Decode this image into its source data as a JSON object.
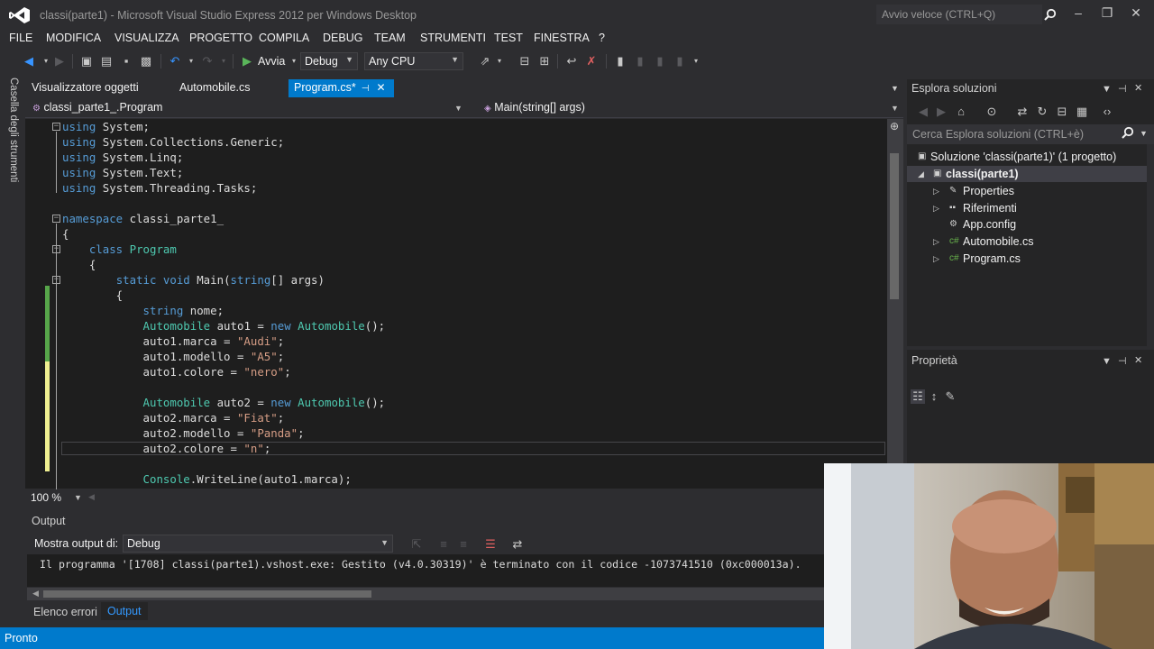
{
  "window": {
    "title": "classi(parte1) - Microsoft Visual Studio Express 2012 per Windows Desktop",
    "quick_launch_placeholder": "Avvio veloce (CTRL+Q)"
  },
  "menu": [
    "FILE",
    "MODIFICA",
    "VISUALIZZA",
    "PROGETTO",
    "COMPILA",
    "DEBUG",
    "TEAM",
    "STRUMENTI",
    "TEST",
    "FINESTRA",
    "?"
  ],
  "toolbar": {
    "start_label": "Avvia",
    "config_value": "Debug",
    "platform_value": "Any CPU"
  },
  "toolbox_label": "Casella degli strumenti",
  "tabs": [
    {
      "label": "Visualizzatore oggetti",
      "active": false
    },
    {
      "label": "Automobile.cs",
      "active": false
    },
    {
      "label": "Program.cs*",
      "active": true
    }
  ],
  "nav": {
    "type_selector": "classi_parte1_.Program",
    "member_selector": "Main(string[] args)"
  },
  "code": [
    [
      [
        "kw",
        "using"
      ],
      [
        "pl",
        " System;"
      ]
    ],
    [
      [
        "kw",
        "using"
      ],
      [
        "pl",
        " System.Collections.Generic;"
      ]
    ],
    [
      [
        "kw",
        "using"
      ],
      [
        "pl",
        " System.Linq;"
      ]
    ],
    [
      [
        "kw",
        "using"
      ],
      [
        "pl",
        " System.Text;"
      ]
    ],
    [
      [
        "kw",
        "using"
      ],
      [
        "pl",
        " System.Threading.Tasks;"
      ]
    ],
    [],
    [
      [
        "kw",
        "namespace"
      ],
      [
        "pl",
        " classi_parte1_"
      ]
    ],
    [
      [
        "pl",
        "{"
      ]
    ],
    [
      [
        "pl",
        "    "
      ],
      [
        "kw",
        "class"
      ],
      [
        "pl",
        " "
      ],
      [
        "ty",
        "Program"
      ]
    ],
    [
      [
        "pl",
        "    {"
      ]
    ],
    [
      [
        "pl",
        "        "
      ],
      [
        "kw",
        "static"
      ],
      [
        "pl",
        " "
      ],
      [
        "kw",
        "void"
      ],
      [
        "pl",
        " Main("
      ],
      [
        "kw",
        "string"
      ],
      [
        "pl",
        "[] args)"
      ]
    ],
    [
      [
        "pl",
        "        {"
      ]
    ],
    [
      [
        "pl",
        "            "
      ],
      [
        "kw",
        "string"
      ],
      [
        "pl",
        " nome;"
      ]
    ],
    [
      [
        "pl",
        "            "
      ],
      [
        "ty",
        "Automobile"
      ],
      [
        "pl",
        " auto1 = "
      ],
      [
        "kw",
        "new"
      ],
      [
        "pl",
        " "
      ],
      [
        "ty",
        "Automobile"
      ],
      [
        "pl",
        "();"
      ]
    ],
    [
      [
        "pl",
        "            auto1.marca = "
      ],
      [
        "st",
        "\"Audi\""
      ],
      [
        "pl",
        ";"
      ]
    ],
    [
      [
        "pl",
        "            auto1.modello = "
      ],
      [
        "st",
        "\"A5\""
      ],
      [
        "pl",
        ";"
      ]
    ],
    [
      [
        "pl",
        "            auto1.colore = "
      ],
      [
        "st",
        "\"nero\""
      ],
      [
        "pl",
        ";"
      ]
    ],
    [],
    [
      [
        "pl",
        "            "
      ],
      [
        "ty",
        "Automobile"
      ],
      [
        "pl",
        " auto2 = "
      ],
      [
        "kw",
        "new"
      ],
      [
        "pl",
        " "
      ],
      [
        "ty",
        "Automobile"
      ],
      [
        "pl",
        "();"
      ]
    ],
    [
      [
        "pl",
        "            auto2.marca = "
      ],
      [
        "st",
        "\"Fiat\""
      ],
      [
        "pl",
        ";"
      ]
    ],
    [
      [
        "pl",
        "            auto2.modello = "
      ],
      [
        "st",
        "\"Panda\""
      ],
      [
        "pl",
        ";"
      ]
    ],
    [
      [
        "pl",
        "            auto2.colore = "
      ],
      [
        "st",
        "\"n\""
      ],
      [
        "pl",
        ";"
      ]
    ],
    [],
    [
      [
        "pl",
        "            "
      ],
      [
        "ty",
        "Console"
      ],
      [
        "pl",
        ".WriteLine(auto1.marca);"
      ]
    ]
  ],
  "zoom": "100 %",
  "output": {
    "title": "Output",
    "show_label": "Mostra output di:",
    "source_value": "Debug",
    "text": "Il programma '[1708] classi(parte1).vshost.exe: Gestito (v4.0.30319)' è terminato con il codice -1073741510 (0xc000013a)."
  },
  "bottom_tabs": {
    "errors": "Elenco errori",
    "output": "Output"
  },
  "status": "Pronto",
  "solution_explorer": {
    "title": "Esplora soluzioni",
    "search_placeholder": "Cerca Esplora soluzioni (CTRL+è)",
    "solution": "Soluzione 'classi(parte1)' (1 progetto)",
    "project": "classi(parte1)",
    "items": [
      "Properties",
      "Riferimenti",
      "App.config",
      "Automobile.cs",
      "Program.cs"
    ]
  },
  "properties": {
    "title": "Proprietà"
  },
  "colors": {
    "accent": "#007acc",
    "background": "#2d2d30",
    "editor": "#1e1e1e",
    "keyword": "#569cd6",
    "type": "#4ec9b0",
    "string": "#d69d85"
  }
}
